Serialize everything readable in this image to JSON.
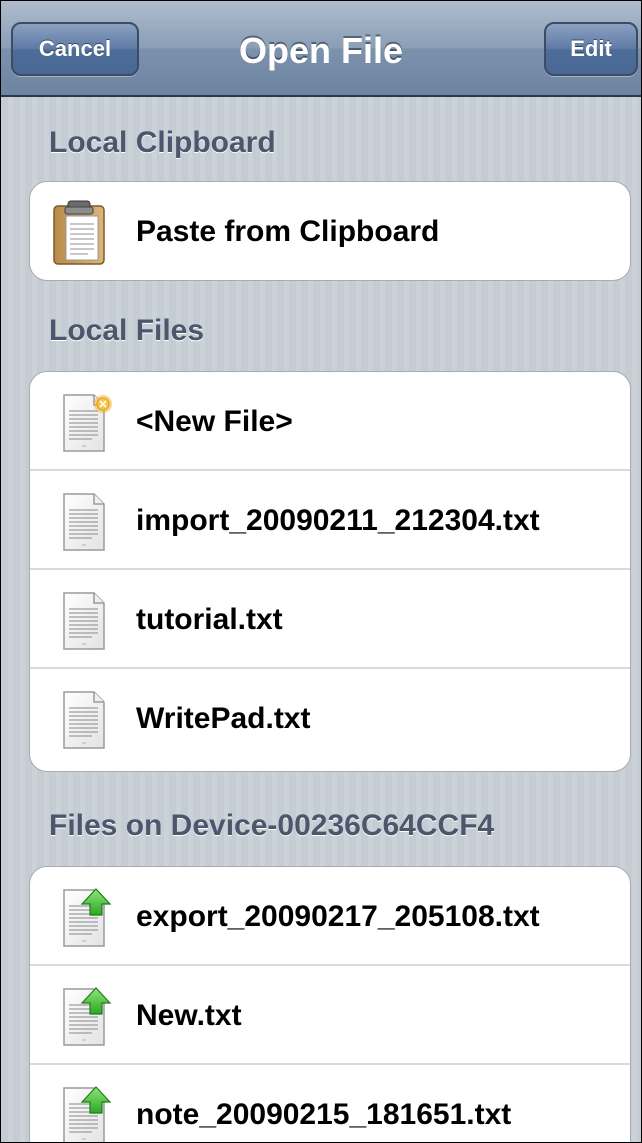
{
  "navbar": {
    "title": "Open File",
    "cancel_label": "Cancel",
    "edit_label": "Edit"
  },
  "sections": {
    "clipboard": {
      "header": "Local Clipboard",
      "items": [
        {
          "label": "Paste from Clipboard",
          "icon": "clipboard-icon"
        }
      ]
    },
    "local_files": {
      "header": "Local Files",
      "items": [
        {
          "label": "<New File>",
          "icon": "new-file-icon"
        },
        {
          "label": "import_20090211_212304.txt",
          "icon": "text-file-icon"
        },
        {
          "label": "tutorial.txt",
          "icon": "text-file-icon"
        },
        {
          "label": "WritePad.txt",
          "icon": "text-file-icon"
        }
      ]
    },
    "device_files": {
      "header": "Files on Device-00236C64CCF4",
      "items": [
        {
          "label": "export_20090217_205108.txt",
          "icon": "upload-file-icon"
        },
        {
          "label": "New.txt",
          "icon": "upload-file-icon"
        },
        {
          "label": "note_20090215_181651.txt",
          "icon": "upload-file-icon"
        }
      ]
    }
  },
  "colors": {
    "navbar": "#7c91ac",
    "background": "#c5ccd4",
    "section_header": "#4c566c",
    "upload_arrow": "#3cbf2e",
    "new_file_badge": "#f5b731"
  }
}
